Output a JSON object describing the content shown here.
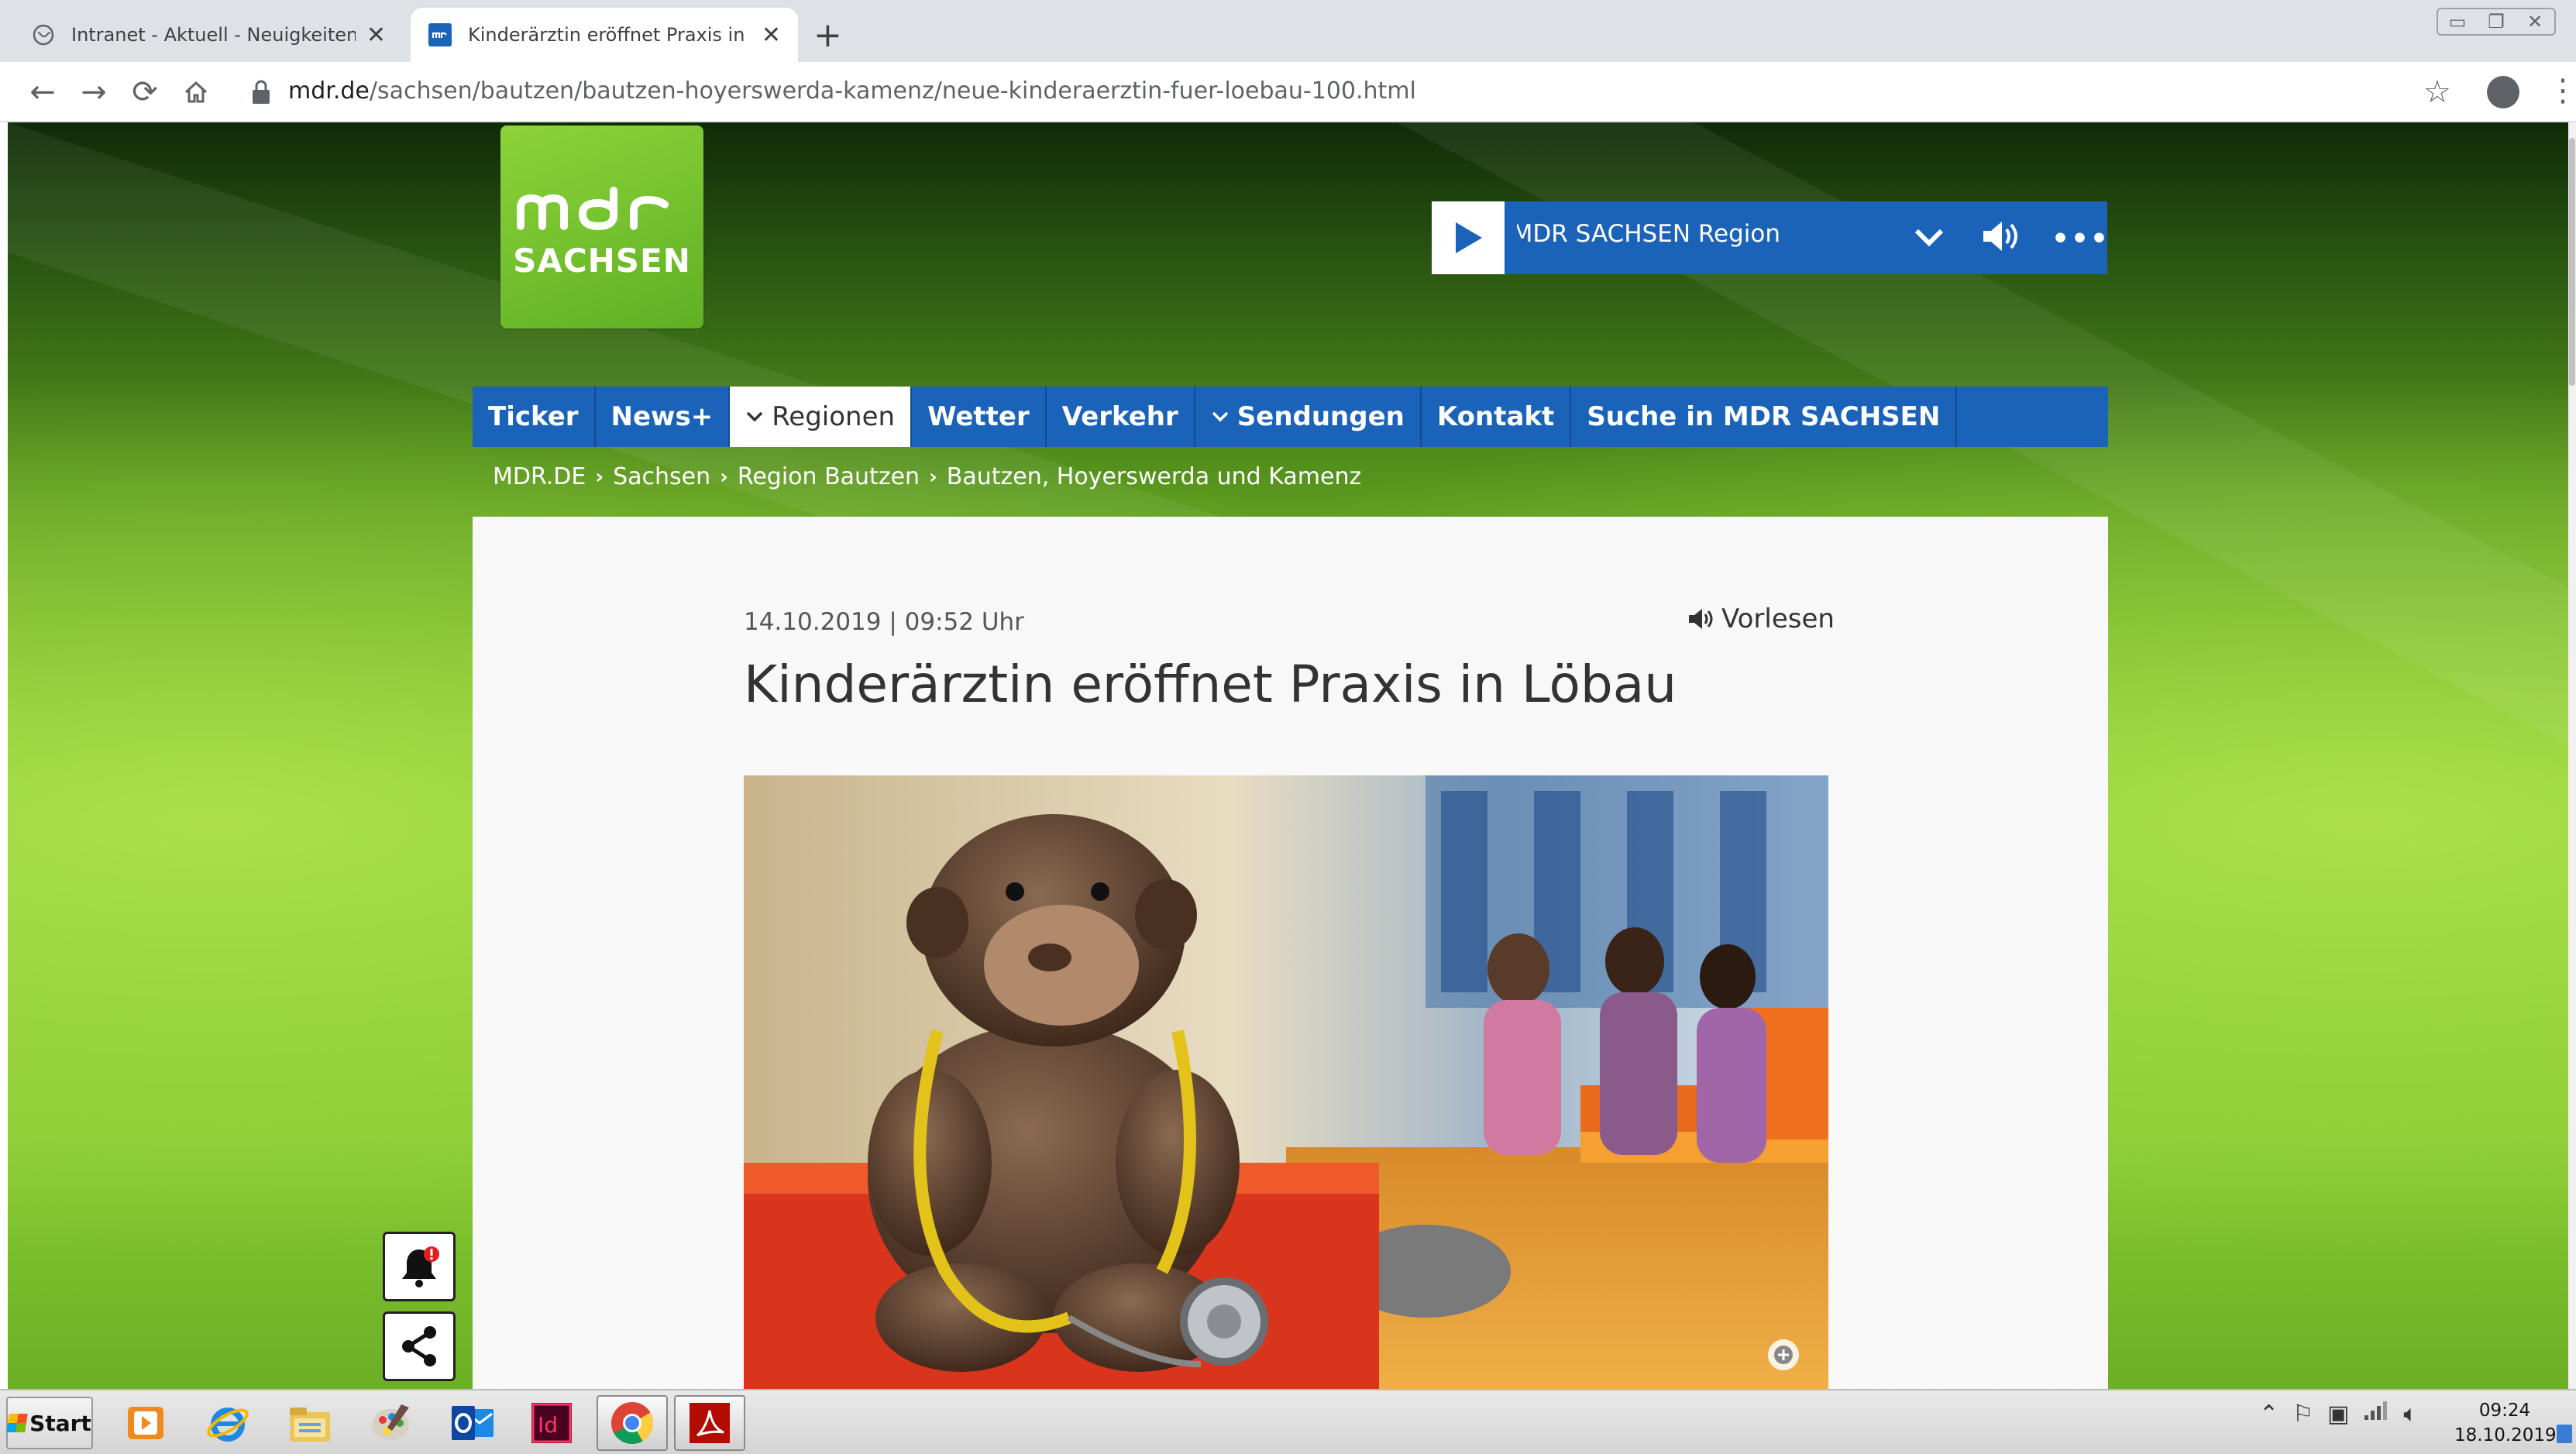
{
  "browser": {
    "tabs": [
      {
        "title": "Intranet - Aktuell - Neuigkeiten",
        "active": false
      },
      {
        "title": "Kinderärztin eröffnet Praxis in Löbau",
        "active": true
      }
    ],
    "new_tab_label": "+",
    "close_label": "✕",
    "url_domain": "mdr.de",
    "url_path": "/sachsen/bautzen/bautzen-hoyerswerda-kamenz/neue-kinderaerztin-fuer-loebau-100.html"
  },
  "site": {
    "logo_text": "SACHSEN",
    "brand_color": "#1a63b8",
    "logo_color": "#72c22b"
  },
  "player": {
    "now_playing": "Hits und Oldies jetzt bei MDR SACHSEN Region"
  },
  "nav": {
    "items": [
      {
        "label": "Ticker",
        "dropdown": false,
        "active": false
      },
      {
        "label": "News+",
        "dropdown": false,
        "active": false
      },
      {
        "label": "Regionen",
        "dropdown": true,
        "active": true
      },
      {
        "label": "Wetter",
        "dropdown": false,
        "active": false
      },
      {
        "label": "Verkehr",
        "dropdown": false,
        "active": false
      },
      {
        "label": "Sendungen",
        "dropdown": true,
        "active": false
      },
      {
        "label": "Kontakt",
        "dropdown": false,
        "active": false
      },
      {
        "label": "Suche in MDR SACHSEN",
        "dropdown": false,
        "active": false
      }
    ]
  },
  "breadcrumb": [
    "MDR.DE",
    "Sachsen",
    "Region Bautzen",
    "Bautzen, Hoyerswerda und Kamenz"
  ],
  "article": {
    "date": "14.10.2019 | 09:52 Uhr",
    "read_aloud": "Vorlesen",
    "title": "Kinderärztin eröffnet Praxis in Löbau"
  },
  "taskbar": {
    "start_label": "Start",
    "clock_time": "09:24",
    "clock_date": "18.10.2019",
    "apps": [
      "media-player-icon",
      "internet-explorer-icon",
      "file-explorer-icon",
      "paint-icon",
      "outlook-icon",
      "indesign-icon",
      "chrome-icon",
      "acrobat-icon"
    ]
  }
}
